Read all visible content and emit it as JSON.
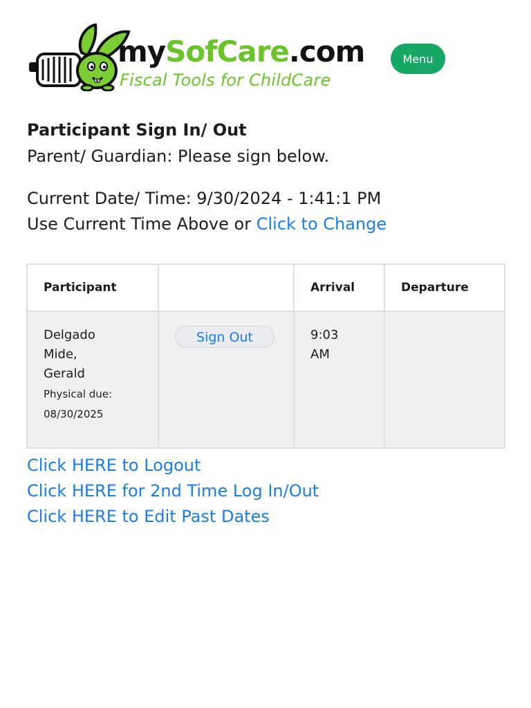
{
  "brand": {
    "wordmark_my": "my",
    "wordmark_brand": "SofCare",
    "wordmark_tld": ".com",
    "tagline": "Fiscal Tools for ChildCare",
    "accent_color": "#6cc42d"
  },
  "header": {
    "menu_label": "Menu",
    "menu_color": "#17a865"
  },
  "page": {
    "title": "Participant Sign In/ Out",
    "instructions": "Parent/ Guardian: Please sign below.",
    "datetime_label": "Current Date/ Time: ",
    "datetime_value": "9/30/2024 - 1:41:1 PM",
    "use_time_text": "Use Current Time Above or ",
    "change_link": "Click to Change"
  },
  "table": {
    "headers": [
      "Participant",
      "",
      "Arrival",
      "Departure"
    ],
    "rows": [
      {
        "name": "Delgado Mide, Gerald",
        "physical_label": "Physical due:",
        "physical_date": "08/30/2025",
        "action_label": "Sign Out",
        "arrival": "9:03 AM",
        "departure": ""
      }
    ]
  },
  "links": {
    "logout": "Click HERE to Logout",
    "second_log": "Click HERE for 2nd Time Log In/Out",
    "edit_past": "Click HERE to Edit Past Dates",
    "link_color": "#1a7ee8"
  }
}
